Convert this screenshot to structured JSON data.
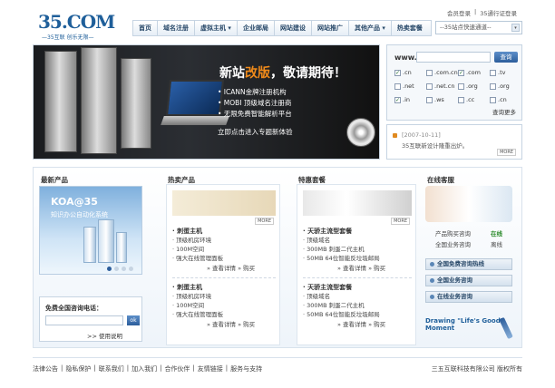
{
  "top_links": {
    "login": "会员登录",
    "sep": "|",
    "passport": "35通行证登录"
  },
  "logo": {
    "text": "35.COM",
    "tagline": "—35互联 创乐无限—"
  },
  "nav": [
    "首页",
    "域名注册",
    "虚拟主机 ▾",
    "企业邮局",
    "网站建设",
    "网站推广",
    "其他产品 ▾",
    "热卖套餐"
  ],
  "quick_select": {
    "value": "--35站点快速通道--",
    "arrow": "▾"
  },
  "banner": {
    "headline_pre": "新站",
    "headline_hl": "改版",
    "headline_post": "，敬请期待！",
    "bullets": [
      "• ICANN金牌注册机构",
      "• MOBI 顶级域名注册商",
      "• 无限免费智能解析平台"
    ],
    "cta": "立即点击进入专题新体验"
  },
  "domain_search": {
    "prefix": "www.",
    "value": "",
    "button": "查询",
    "tlds": [
      {
        "label": ".cn",
        "checked": true
      },
      {
        "label": ".com.cn",
        "checked": false
      },
      {
        "label": ".com",
        "checked": true
      },
      {
        "label": ".tv",
        "checked": false
      },
      {
        "label": ".net",
        "checked": false
      },
      {
        "label": ".net.cn",
        "checked": false
      },
      {
        "label": ".org",
        "checked": false
      },
      {
        "label": ".org",
        "checked": false
      },
      {
        "label": ".in",
        "checked": true
      },
      {
        "label": ".ws",
        "checked": false
      },
      {
        "label": ".cc",
        "checked": false
      },
      {
        "label": ".cn",
        "checked": false
      }
    ],
    "more": "查询更多"
  },
  "news": {
    "date": "[2007-10-11]",
    "text": "35互联新设计隆重出炉。",
    "more": "MORE"
  },
  "newest": {
    "title": "最新产品",
    "koa_title": "KOA@35",
    "koa_sub": "知识办公自动化系统"
  },
  "hotline_left": {
    "title": "免费全国咨询电话：",
    "ok": "ok",
    "help": ">> 使用说明"
  },
  "hot_products": {
    "title": "热卖产品",
    "more": "MORE",
    "groups": [
      {
        "title": "· 刺蛋主机",
        "lines": [
          "· 顶级机房环境",
          "· 100M空间",
          "· 强大在线管理面板"
        ],
        "detail": "查看详情",
        "buy": "购买"
      },
      {
        "title": "· 刺蛋主机",
        "lines": [
          "· 顶级机房环境",
          "· 100M空间",
          "· 强大在线管理面板"
        ],
        "detail": "查看详情",
        "buy": "购买"
      }
    ]
  },
  "special": {
    "title": "特惠套餐",
    "more": "MORE",
    "groups": [
      {
        "title": "· 天骄主流型套餐",
        "lines": [
          "· 顶级域名",
          "· 300MB 刺蛋二代主机",
          "· 50MB 64位智能反垃圾邮局"
        ],
        "detail": "查看详情",
        "buy": "购买"
      },
      {
        "title": "· 天骄主流型套餐",
        "lines": [
          "· 顶级域名",
          "· 300MB 刺蛋二代主机",
          "· 50MB 64位智能反垃圾邮局"
        ],
        "detail": "查看详情",
        "buy": "购买"
      }
    ]
  },
  "service": {
    "title": "在线客服",
    "pre_sales": "产品购买咨询",
    "online": "在线",
    "biz": "全国业务咨询",
    "busy": "离线",
    "buttons": [
      "全国免费咨询热线",
      "全国业务咨询",
      "在线业务咨询"
    ],
    "drawing_l1": "Drawing \"Life's Good\"",
    "drawing_l2": "Moment"
  },
  "footer": {
    "links": [
      "法律公告",
      "|",
      "隐私保护",
      "|",
      "联系我们",
      "|",
      "加入我们",
      "|",
      "合作伙伴",
      "|",
      "友情链接",
      "|",
      "服务与支持"
    ],
    "copyright": "三五互联科技有限公司 版权所有"
  }
}
